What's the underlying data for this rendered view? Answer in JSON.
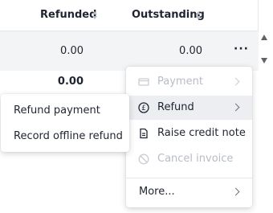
{
  "table": {
    "columns": [
      {
        "label": "Refunded"
      },
      {
        "label": "Outstanding"
      }
    ],
    "rows": [
      {
        "refunded": "0.00",
        "outstanding": "0.00",
        "actions": "···"
      },
      {
        "refunded": "0.00"
      }
    ]
  },
  "context_menu": {
    "items": [
      {
        "label": "Payment",
        "icon": "card-icon",
        "state": "disabled",
        "has_submenu": true
      },
      {
        "label": "Refund",
        "icon": "pound-coin-icon",
        "state": "active",
        "has_submenu": true
      },
      {
        "label": "Raise credit note",
        "icon": "document-icon",
        "state": "enabled",
        "has_submenu": false
      },
      {
        "label": "Cancel invoice",
        "icon": "cancel-icon",
        "state": "disabled",
        "has_submenu": false
      }
    ],
    "more": {
      "label": "More...",
      "has_submenu": true
    }
  },
  "refund_submenu": {
    "items": [
      {
        "label": "Refund payment"
      },
      {
        "label": "Record offline refund"
      }
    ]
  },
  "colors": {
    "text": "#1f2430",
    "disabled_text": "#b8bcc4",
    "row_bg": "#f3f4f6",
    "active_item_bg": "#eceef1",
    "border": "#e5e7eb"
  }
}
